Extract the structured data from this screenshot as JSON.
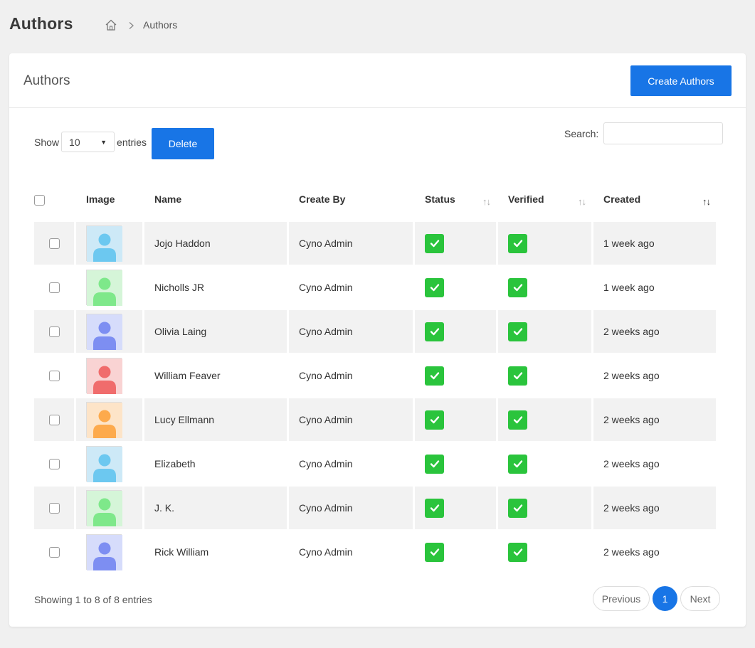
{
  "header": {
    "title": "Authors",
    "breadcrumb": {
      "current": "Authors"
    }
  },
  "card": {
    "title": "Authors",
    "create_label": "Create Authors"
  },
  "controls": {
    "show_label": "Show",
    "entries_value": "10",
    "entries_label": "entries",
    "delete_label": "Delete",
    "search_label": "Search:",
    "search_value": ""
  },
  "table": {
    "columns": [
      "Image",
      "Name",
      "Create By",
      "Status",
      "Verified",
      "Created"
    ],
    "rows": [
      {
        "avatar": "blue-light",
        "name": "Jojo Haddon",
        "created_by": "Cyno Admin",
        "status": true,
        "verified": true,
        "created": "1 week ago"
      },
      {
        "avatar": "green",
        "name": "Nicholls JR",
        "created_by": "Cyno Admin",
        "status": true,
        "verified": true,
        "created": "1 week ago"
      },
      {
        "avatar": "indigo",
        "name": "Olivia Laing",
        "created_by": "Cyno Admin",
        "status": true,
        "verified": true,
        "created": "2 weeks ago"
      },
      {
        "avatar": "red",
        "name": "William Feaver",
        "created_by": "Cyno Admin",
        "status": true,
        "verified": true,
        "created": "2 weeks ago"
      },
      {
        "avatar": "orange",
        "name": "Lucy Ellmann",
        "created_by": "Cyno Admin",
        "status": true,
        "verified": true,
        "created": "2 weeks ago"
      },
      {
        "avatar": "blue-light",
        "name": "Elizabeth",
        "created_by": "Cyno Admin",
        "status": true,
        "verified": true,
        "created": "2 weeks ago"
      },
      {
        "avatar": "green",
        "name": "J. K.",
        "created_by": "Cyno Admin",
        "status": true,
        "verified": true,
        "created": "2 weeks ago"
      },
      {
        "avatar": "indigo",
        "name": "Rick William",
        "created_by": "Cyno Admin",
        "status": true,
        "verified": true,
        "created": "2 weeks ago"
      }
    ]
  },
  "footer": {
    "info": "Showing 1 to 8 of 8 entries",
    "previous_label": "Previous",
    "current_page": "1",
    "next_label": "Next"
  },
  "colors": {
    "primary": "#1875e6",
    "check": "#2ac43c",
    "avatars": {
      "blue-light": {
        "bg": "#cde9f7",
        "fg": "#6cc8f0"
      },
      "green": {
        "bg": "#d5f5d8",
        "fg": "#7ee88a"
      },
      "indigo": {
        "bg": "#d6dcfb",
        "fg": "#7d8ef2"
      },
      "red": {
        "bg": "#f9d3d3",
        "fg": "#f06c6c"
      },
      "orange": {
        "bg": "#fde4c8",
        "fg": "#fdaa4c"
      }
    }
  }
}
